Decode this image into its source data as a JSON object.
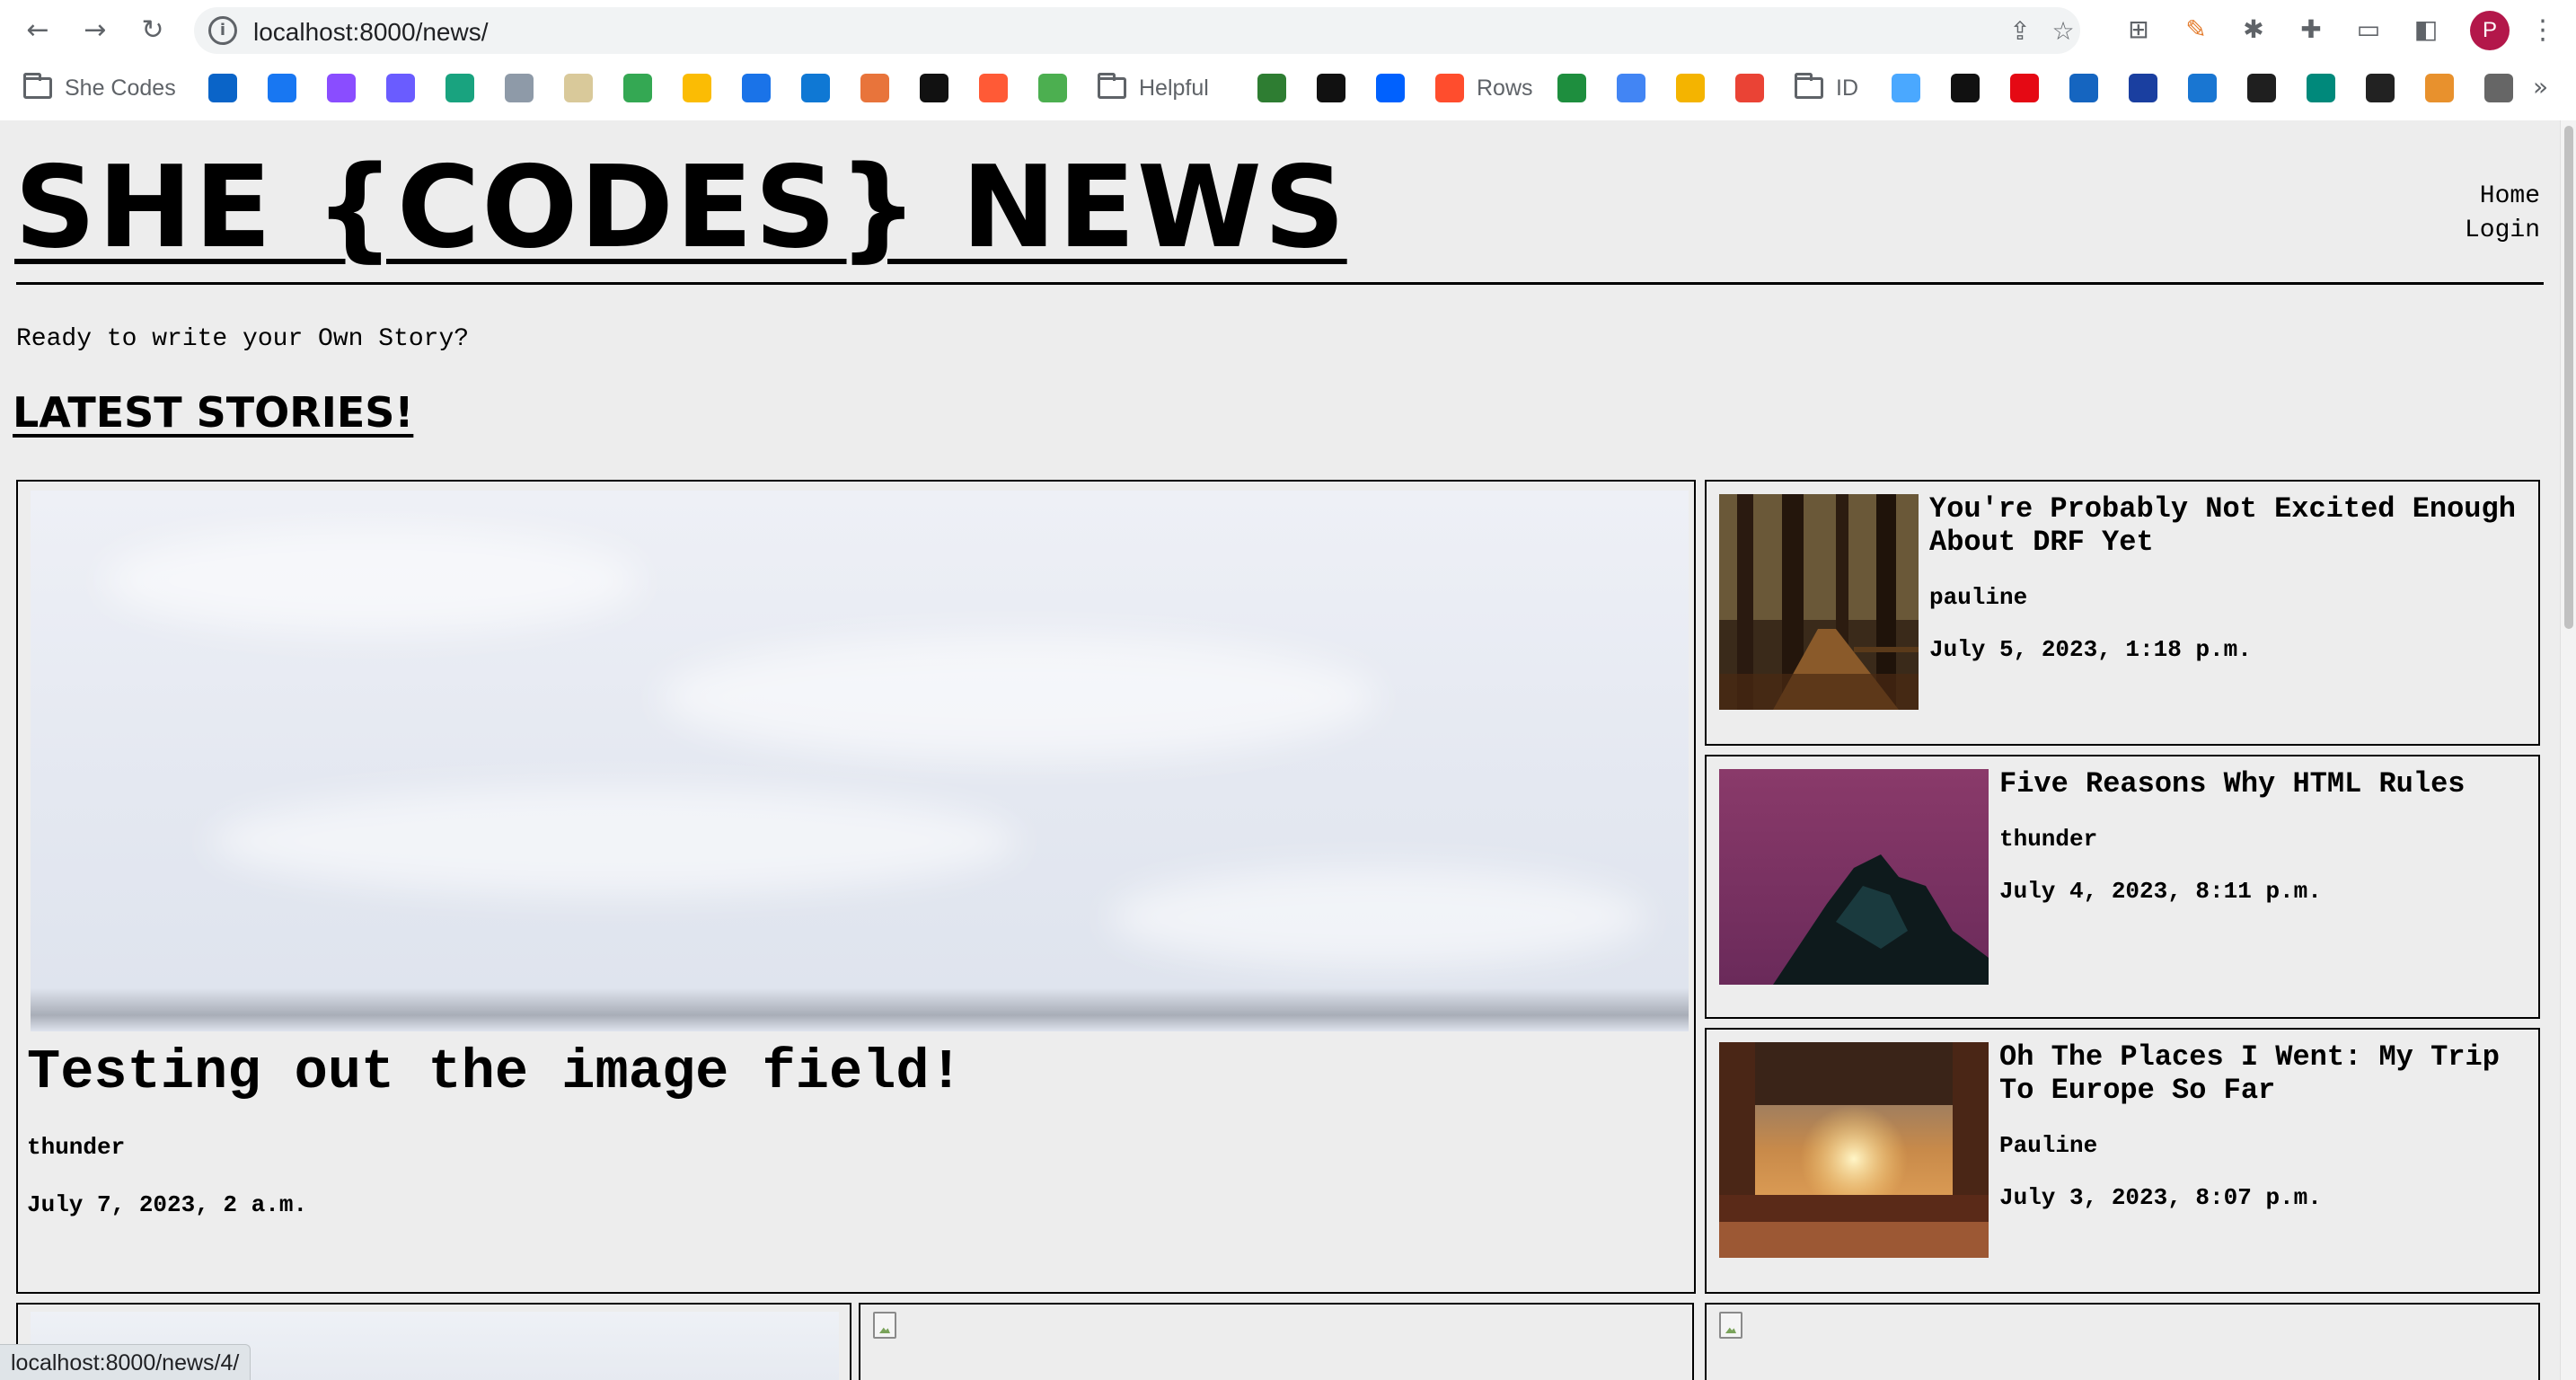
{
  "browser": {
    "url": "localhost:8000/news/",
    "status_url": "localhost:8000/news/4/",
    "avatar_initial": "P",
    "bookmarks": [
      {
        "label": "She Codes",
        "icon": "folder-icon",
        "color": "#5f6368"
      },
      {
        "label": "",
        "icon": "outlook-icon",
        "color": "#0a64c8"
      },
      {
        "label": "",
        "icon": "facebook-icon",
        "color": "#1877f2"
      },
      {
        "label": "",
        "icon": "messenger-icon",
        "color": "#8a4dff"
      },
      {
        "label": "",
        "icon": "gemini-icon",
        "color": "#6a5cff"
      },
      {
        "label": "",
        "icon": "chatgpt-icon",
        "color": "#19a37f"
      },
      {
        "label": "",
        "icon": "disc-icon",
        "color": "#8e9aa8"
      },
      {
        "label": "",
        "icon": "goodreads-icon",
        "color": "#d9c99a"
      },
      {
        "label": "",
        "icon": "maps-icon",
        "color": "#34a853"
      },
      {
        "label": "",
        "icon": "photos-icon",
        "color": "#fbbc04"
      },
      {
        "label": "",
        "icon": "drive-icon",
        "color": "#1a73e8"
      },
      {
        "label": "",
        "icon": "onedrive-icon",
        "color": "#0f78d4"
      },
      {
        "label": "",
        "icon": "animal-icon",
        "color": "#e8743b"
      },
      {
        "label": "",
        "icon": "u-icon",
        "color": "#111111"
      },
      {
        "label": "",
        "icon": "plane-icon",
        "color": "#ff5a36"
      },
      {
        "label": "",
        "icon": "leaf-icon",
        "color": "#4caf50"
      },
      {
        "label": "Helpful",
        "icon": "folder-icon",
        "color": "#5f6368"
      },
      {
        "label": "",
        "icon": "infinity-icon",
        "color": "#2e7d32"
      },
      {
        "label": "",
        "icon": "notion-icon",
        "color": "#111111"
      },
      {
        "label": "",
        "icon": "dropbox-icon",
        "color": "#0061fe"
      },
      {
        "label": "Rows",
        "icon": "rows-icon",
        "color": "#ff4d2d"
      },
      {
        "label": "",
        "icon": "plus-icon",
        "color": "#1e8e3e"
      },
      {
        "label": "",
        "icon": "docs-icon",
        "color": "#4285f4"
      },
      {
        "label": "",
        "icon": "triangle-icon",
        "color": "#f4b400"
      },
      {
        "label": "",
        "icon": "gmail-icon",
        "color": "#ea4335"
      },
      {
        "label": "ID",
        "icon": "folder-icon",
        "color": "#5f6368"
      },
      {
        "label": "",
        "icon": "circle-icon",
        "color": "#4aa8ff"
      },
      {
        "label": "",
        "icon": "a-icon",
        "color": "#111111"
      },
      {
        "label": "",
        "icon": "netflix-icon",
        "color": "#e50914"
      },
      {
        "label": "",
        "icon": "play-icon",
        "color": "#1565c0"
      },
      {
        "label": "",
        "icon": "disney-icon",
        "color": "#1a3fa0"
      },
      {
        "label": "",
        "icon": "s-icon",
        "color": "#1976d2"
      },
      {
        "label": "",
        "icon": "plex-icon",
        "color": "#1f1f1f"
      },
      {
        "label": "",
        "icon": "c-icon",
        "color": "#00897b"
      },
      {
        "label": "",
        "icon": "stripes-icon",
        "color": "#222222"
      },
      {
        "label": "",
        "icon": "orange-icon",
        "color": "#e8912d"
      },
      {
        "label": "",
        "icon": "apple-icon",
        "color": "#666666"
      }
    ],
    "more_bookmarks": "»"
  },
  "site": {
    "title": "SHE {CODES} NEWS",
    "nav": [
      "Home",
      "Login"
    ],
    "prompt": "Ready to write your Own Story?",
    "section_heading": "LATEST STORIES!"
  },
  "featured": {
    "title": "Testing out the image field!",
    "author": "thunder",
    "date": "July 7, 2023, 2 a.m."
  },
  "side_stories": [
    {
      "title": "You're Probably Not Excited Enough About DRF Yet",
      "author": "pauline",
      "date": "July 5, 2023, 1:18 p.m."
    },
    {
      "title": "Five Reasons Why HTML Rules",
      "author": "thunder",
      "date": "July 4, 2023, 8:11 p.m."
    },
    {
      "title": "Oh The Places I Went: My Trip To Europe So Far",
      "author": "Pauline",
      "date": "July 3, 2023, 8:07 p.m."
    }
  ]
}
